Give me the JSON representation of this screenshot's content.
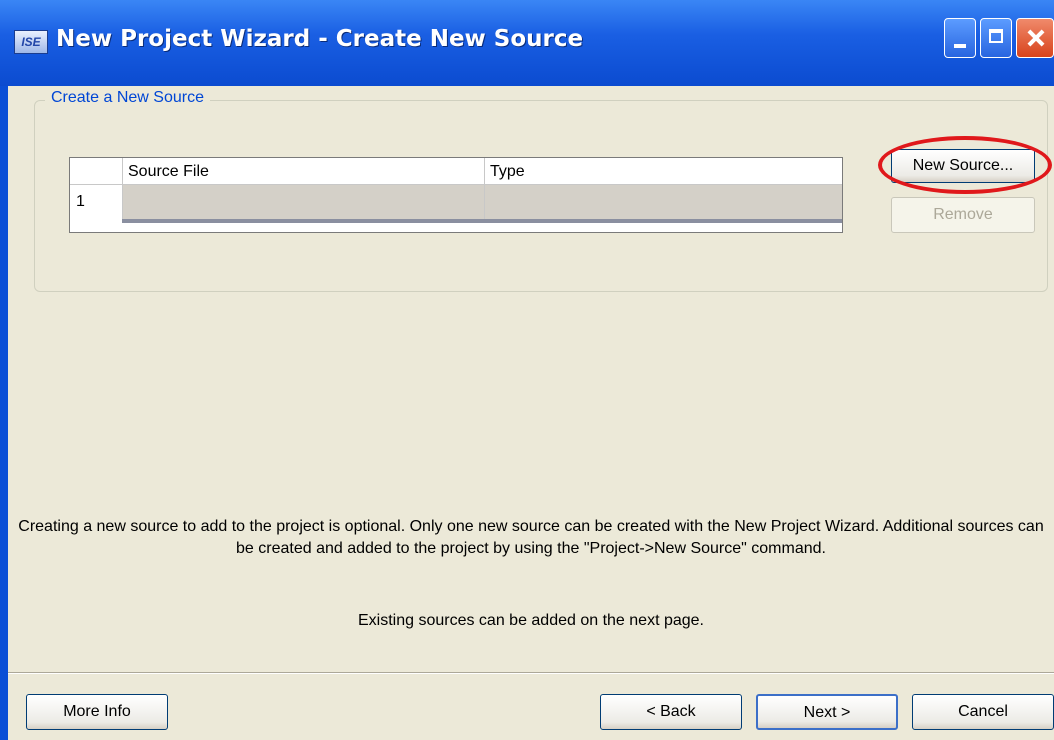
{
  "window": {
    "title": "New Project Wizard - Create New Source",
    "app_icon_text": "ISE"
  },
  "group": {
    "title": "Create a New Source"
  },
  "grid": {
    "columns": [
      "Source File",
      "Type"
    ],
    "rows": [
      {
        "num": "1",
        "source_file": "",
        "type": ""
      }
    ]
  },
  "buttons": {
    "new_source": "New Source...",
    "remove": "Remove",
    "more_info": "More Info",
    "back": "< Back",
    "next": "Next >",
    "cancel": "Cancel"
  },
  "description": {
    "line1": "Creating a new source to add to the project is optional. Only one new source can be created with the New Project Wizard. Additional sources can be created and added to the project by using the \"Project->New Source\" command.",
    "line2": "Existing sources can be added on the next page."
  },
  "colors": {
    "highlight": "#e0181b",
    "title_bar": "#0b4bd0",
    "group_title": "#0046d5"
  }
}
